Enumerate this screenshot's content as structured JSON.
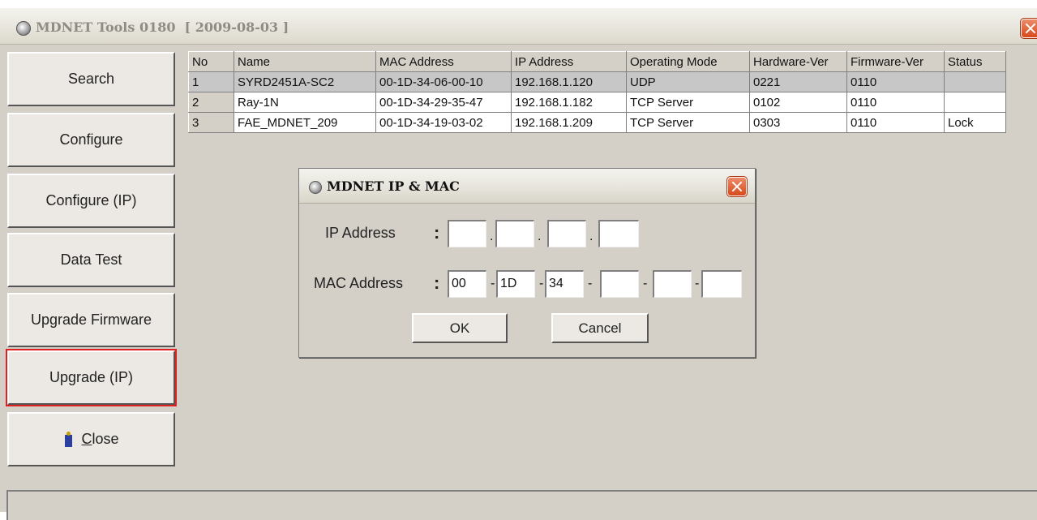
{
  "window": {
    "title": "MDNET Tools 0180",
    "date": "[ 2009-08-03 ]"
  },
  "sidebar": {
    "buttons": [
      {
        "label": "Search"
      },
      {
        "label": "Configure"
      },
      {
        "label": "Configure (IP)"
      },
      {
        "label": "Data Test"
      },
      {
        "label": "Upgrade Firmware"
      },
      {
        "label": "Upgrade (IP)",
        "highlighted": true
      },
      {
        "label": "Close",
        "icon": "door-exit-icon",
        "mnemonic": "C"
      }
    ]
  },
  "table": {
    "columns": [
      "No",
      "Name",
      "MAC Address",
      "IP Address",
      "Operating Mode",
      "Hardware-Ver",
      "Firmware-Ver",
      "Status"
    ],
    "rows": [
      [
        "1",
        "SYRD2451A-SC2",
        "00-1D-34-06-00-10",
        "192.168.1.120",
        "UDP",
        "0221",
        "0110",
        ""
      ],
      [
        "2",
        "Ray-1N",
        "00-1D-34-29-35-47",
        "192.168.1.182",
        "TCP Server",
        "0102",
        "0110",
        ""
      ],
      [
        "3",
        "FAE_MDNET_209",
        "00-1D-34-19-03-02",
        "192.168.1.209",
        "TCP Server",
        "0303",
        "0110",
        "Lock"
      ]
    ],
    "selected_row": 0
  },
  "dialog": {
    "title": "MDNET IP & MAC",
    "ip_label": "IP Address",
    "mac_label": "MAC Address",
    "colon": ":",
    "ip_dot": ".",
    "mac_dash": "-",
    "ip_fields": [
      "",
      "",
      "",
      ""
    ],
    "mac_fields": [
      "00",
      "1D",
      "34",
      "",
      "",
      ""
    ],
    "ok_label": "OK",
    "cancel_label": "Cancel"
  },
  "colors": {
    "highlight_border": "#e02020",
    "selected_row": "#c7c7c7",
    "face": "#d4d0c8"
  }
}
